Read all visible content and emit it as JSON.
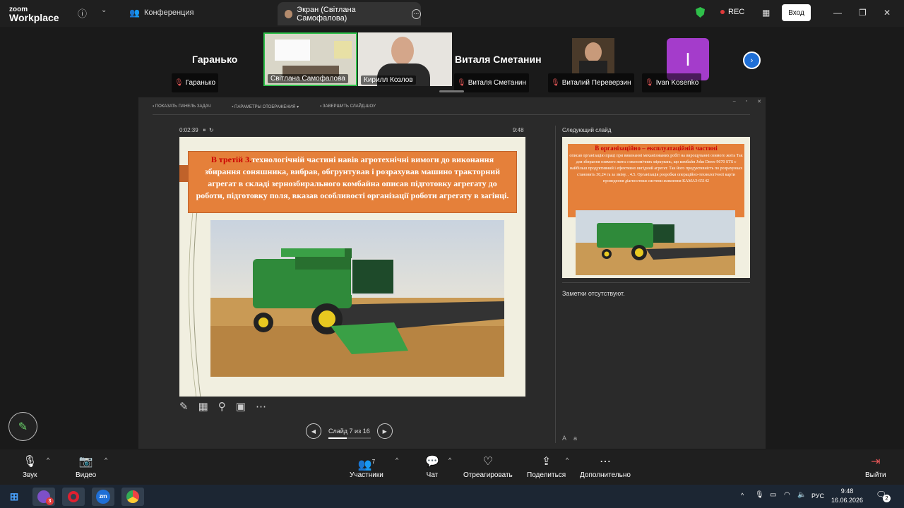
{
  "topbar": {
    "logo_small": "zoom",
    "logo_big": "Workplace",
    "tab_conference": "Конференция",
    "tab_screen": "Экран (Світлана Самофалова)",
    "rec": "REC",
    "login": "Вход"
  },
  "participants": {
    "left_bigname": "Гаранько",
    "right_bigname": "Виталя Сметанин",
    "tiles": [
      {
        "name": "Гаранько"
      },
      {
        "name": "Світлана Самофалова"
      },
      {
        "name": "Кирилл Козлов"
      },
      {
        "name": "Виталя Сметанин"
      },
      {
        "name": "Виталий Переверзин"
      },
      {
        "name": "Ivan Kosenko"
      }
    ],
    "avatar_letter": "I"
  },
  "presenter": {
    "toolbar": [
      "ПОКАЗАТЬ ПАНЕЛЬ ЗАДАЧ",
      "ПАРАМЕТРЫ ОТОБРАЖЕНИЯ ▾",
      "ЗАВЕРШИТЬ СЛАЙД-ШОУ"
    ],
    "elapsed": "0:02:39",
    "clock": "9:48",
    "slide_title_red": "В третій 3.",
    "slide_title_rest": "технологічній частині  навів агротехнічні вимоги до виконання збирання соняшника, вибрав, обгрунтував і розрахував машино тракторний агрегат в складі зернозбирального комбайна описав підготовку агрегату до роботи, підготовку поля, вказав особливості організації  роботи агрегату  в загінці.",
    "next_label": "Следующий слайд",
    "next_title": "В організаційно – експлуатаційній частині",
    "next_body": "описав організацію праці при виконанні механізованих робіт на вирощуванні озимого жита Так для збирання озимого жита з економічних міркувань, що комбайн John Deere 9670 STS є найбільш продуктивний і ефективно вигідний агрегат. Так його продуктивність по розрахунках становить 30,24 га за зміну.  . 4.5. Організація розробки операційно-технологічної карти проведення діагностики системи живлення КАМАЗ-65142",
    "notes": "Заметки отсутствуют.",
    "slide_counter": "Слайд 7 из 16",
    "progress": 0.44
  },
  "bottombar": {
    "sound": "Звук",
    "video": "Видео",
    "participants": "Участники",
    "participants_count": "7",
    "chat": "Чат",
    "react": "Отреагировать",
    "share": "Поделиться",
    "more": "Дополнительно",
    "leave": "Выйти"
  },
  "taskbar": {
    "badge": "3",
    "lang": "РУС",
    "time": "9:48",
    "date": "16.06.2026",
    "notif": "2"
  },
  "colors": {
    "accent_green": "#2fbf4a",
    "rec_red": "#e03a3a",
    "slide_orange": "#e5803a",
    "avatar_purple": "#a43ccb"
  }
}
